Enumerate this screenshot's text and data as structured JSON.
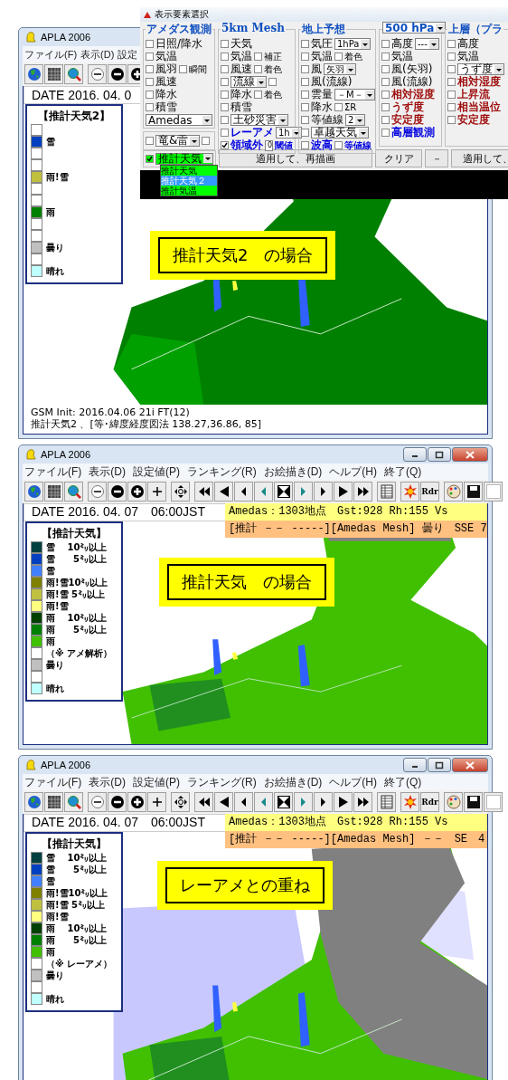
{
  "dialog": {
    "title": "表示要素選択",
    "columns": [
      {
        "groups": [
          {
            "title": "アメダス観測",
            "rows": [
              [
                {
                  "kind": "check",
                  "checked": false,
                  "label": "日照/降水"
                }
              ],
              [
                {
                  "kind": "check",
                  "checked": false,
                  "label": "気温"
                }
              ],
              [
                {
                  "kind": "check",
                  "checked": false,
                  "label": "風羽"
                },
                {
                  "kind": "check",
                  "checked": false,
                  "label": "瞬間"
                }
              ],
              [
                {
                  "kind": "check",
                  "checked": false,
                  "label": "風速"
                }
              ],
              [
                {
                  "kind": "check",
                  "checked": false,
                  "label": "降水"
                }
              ],
              [
                {
                  "kind": "check",
                  "checked": false,
                  "label": "積雪"
                }
              ],
              [
                {
                  "kind": "select",
                  "value": "Amedas"
                }
              ]
            ]
          },
          {
            "rows": [
              [
                {
                  "kind": "check",
                  "checked": false
                },
                {
                  "kind": "select",
                  "value": "竜&雷"
                },
                {
                  "kind": "check",
                  "checked": false
                }
              ]
            ]
          }
        ]
      },
      {
        "groups": [
          {
            "title": "5km Mesh",
            "rows": [
              [
                {
                  "kind": "check",
                  "checked": false,
                  "label": "天気"
                }
              ],
              [
                {
                  "kind": "check",
                  "checked": false,
                  "label": "気温"
                },
                {
                  "kind": "check",
                  "checked": false,
                  "label": "補正"
                }
              ],
              [
                {
                  "kind": "check",
                  "checked": false,
                  "label": "風速"
                },
                {
                  "kind": "check",
                  "checked": false,
                  "label": "着色"
                }
              ],
              [
                {
                  "kind": "check",
                  "checked": false
                },
                {
                  "kind": "select",
                  "value": "流線"
                },
                {
                  "kind": "check",
                  "checked": false
                }
              ],
              [
                {
                  "kind": "check",
                  "checked": false,
                  "label": "降水"
                },
                {
                  "kind": "check",
                  "checked": false,
                  "label": "着色"
                }
              ],
              [
                {
                  "kind": "check",
                  "checked": false,
                  "label": "積雪"
                }
              ],
              [
                {
                  "kind": "check",
                  "checked": false
                },
                {
                  "kind": "select",
                  "value": "土砂災害"
                }
              ],
              [
                {
                  "kind": "check",
                  "checked": false,
                  "label": "レーアメ",
                  "color": "#0000e0"
                },
                {
                  "kind": "select",
                  "value": "1h"
                }
              ],
              [
                {
                  "kind": "check",
                  "checked": true,
                  "label": "領域外",
                  "color": "#0000e0"
                },
                {
                  "kind": "input",
                  "value": "0"
                },
                {
                  "kind": "text",
                  "text": "閾値",
                  "color": "#0000e0"
                }
              ]
            ]
          }
        ]
      },
      {
        "groups": [
          {
            "title": "地上予想",
            "rows": [
              [
                {
                  "kind": "check",
                  "checked": false,
                  "label": "気圧"
                },
                {
                  "kind": "select",
                  "value": "1hPa"
                }
              ],
              [
                {
                  "kind": "check",
                  "checked": false,
                  "label": "気温"
                },
                {
                  "kind": "check",
                  "checked": false,
                  "label": "着色"
                }
              ],
              [
                {
                  "kind": "check",
                  "checked": false,
                  "label": "風"
                },
                {
                  "kind": "select",
                  "value": "矢羽"
                }
              ],
              [
                {
                  "kind": "check",
                  "checked": false,
                  "label": "風(流線)"
                }
              ],
              [
                {
                  "kind": "check",
                  "checked": false,
                  "label": "雲量"
                },
                {
                  "kind": "select",
                  "value": "－M－"
                }
              ],
              [
                {
                  "kind": "check",
                  "checked": false,
                  "label": "降水"
                },
                {
                  "kind": "check",
                  "checked": false,
                  "label": "ΣR"
                }
              ],
              [
                {
                  "kind": "check",
                  "checked": false,
                  "label": "等値線"
                },
                {
                  "kind": "select",
                  "value": "2"
                }
              ],
              [
                {
                  "kind": "check",
                  "checked": false
                },
                {
                  "kind": "select",
                  "value": "卓越天気"
                }
              ],
              [
                {
                  "kind": "check",
                  "checked": false,
                  "label": "波高",
                  "color": "#0000e0"
                },
                {
                  "kind": "check",
                  "checked": false,
                  "label": "等値線",
                  "color": "#0000e0"
                }
              ]
            ]
          }
        ]
      },
      {
        "groups": [
          {
            "title_select": "500 hPa",
            "rows": [
              [
                {
                  "kind": "check",
                  "checked": false,
                  "label": "高度"
                },
                {
                  "kind": "select",
                  "value": "---"
                }
              ],
              [
                {
                  "kind": "check",
                  "checked": false,
                  "label": "気温"
                }
              ],
              [
                {
                  "kind": "check",
                  "checked": false,
                  "label": "風(矢羽)"
                }
              ],
              [
                {
                  "kind": "check",
                  "checked": false,
                  "label": "風(流線)"
                }
              ],
              [
                {
                  "kind": "check",
                  "checked": false,
                  "label": "相対湿度",
                  "color": "#a01010"
                }
              ],
              [
                {
                  "kind": "check",
                  "checked": false,
                  "label": "うず度",
                  "color": "#a01010"
                }
              ],
              [
                {
                  "kind": "check",
                  "checked": false,
                  "label": "安定度",
                  "color": "#a01010"
                }
              ],
              [
                {
                  "kind": "check",
                  "checked": false,
                  "label": "高層観測",
                  "color": "#0000e0"
                }
              ]
            ]
          }
        ]
      },
      {
        "groups": [
          {
            "title": "上層（プラ",
            "rows": [
              [
                {
                  "kind": "check",
                  "checked": false,
                  "label": "高度"
                }
              ],
              [
                {
                  "kind": "check",
                  "checked": false,
                  "label": "気温"
                }
              ],
              [
                {
                  "kind": "check",
                  "checked": false
                },
                {
                  "kind": "select",
                  "value": "うず度"
                }
              ],
              [
                {
                  "kind": "check",
                  "checked": false,
                  "label": "相対湿度",
                  "color": "#a01010"
                }
              ],
              [
                {
                  "kind": "check",
                  "checked": false,
                  "label": "上昇流",
                  "color": "#a01010"
                }
              ],
              [
                {
                  "kind": "check",
                  "checked": false,
                  "label": "相当温位",
                  "color": "#a01010"
                }
              ],
              [
                {
                  "kind": "check",
                  "checked": false,
                  "label": "安定度",
                  "color": "#a01010"
                }
              ]
            ]
          }
        ]
      }
    ],
    "weather": {
      "checked": true,
      "value": "推計天気"
    },
    "buttons": [
      "適用して、再描画",
      "クリア",
      "－",
      "適用して、"
    ],
    "options": [
      {
        "label": "推計天気",
        "selected": false
      },
      {
        "label": "推計天気２",
        "selected": true
      },
      {
        "label": "推計気温",
        "selected": false
      }
    ]
  },
  "windows": [
    {
      "title": "APLA 2006",
      "menu": [
        "ファイル(F)",
        "表示(D)",
        "設定"
      ],
      "toolbar": [
        [
          {
            "kind": "globe"
          },
          {
            "kind": "grid"
          },
          {
            "kind": "search-globe"
          }
        ],
        [
          {
            "kind": "minus"
          },
          {
            "kind": "minus-circle"
          },
          {
            "kind": "plus-circle"
          }
        ]
      ],
      "date": "DATE 2016. 04. 0",
      "legend": {
        "title": "【推計天気2】",
        "rows": [
          {
            "color": "#ffffff"
          },
          {
            "label": "雪",
            "color": "#0040c0"
          },
          {
            "color": "#ffffff"
          },
          {
            "color": "#ffffff"
          },
          {
            "label": "雨!雪",
            "color": "#c0c040"
          },
          {
            "color": "#ffffff"
          },
          {
            "color": "#ffffff"
          },
          {
            "label": "雨",
            "color": "#008000"
          },
          {
            "color": "#ffffff"
          },
          {
            "color": "#ffffff"
          },
          {
            "label": "曇り",
            "color": "#c0c0c0"
          },
          {
            "color": "#ffffff"
          },
          {
            "label": "晴れ",
            "color": "#c0ffff"
          }
        ]
      },
      "caption": "推計天気2　の場合",
      "status": [
        "GSM Init: 2016.04.06 21i FT(12)",
        "推計天気2 、[等･緯度経度図法 138.27,36.86, 85]"
      ]
    },
    {
      "title": "APLA 2006",
      "controls": true,
      "menu": [
        "ファイル(F)",
        "表示(D)",
        "設定値(P)",
        "ランキング(R)",
        "お絵描き(D)",
        "ヘルプ(H)",
        "終了(Q)"
      ],
      "toolbar": [
        [
          {
            "kind": "globe"
          },
          {
            "kind": "grid"
          },
          {
            "kind": "search-globe"
          }
        ],
        [
          {
            "kind": "minus"
          },
          {
            "kind": "minus-circle"
          },
          {
            "kind": "plus-circle"
          },
          {
            "kind": "plus"
          }
        ],
        [
          {
            "kind": "move"
          }
        ],
        [
          {
            "kind": "skip-back"
          },
          {
            "kind": "back-large"
          },
          {
            "kind": "back"
          },
          {
            "kind": "back-teal"
          },
          {
            "kind": "hourglass"
          },
          {
            "kind": "forward-teal"
          },
          {
            "kind": "forward"
          },
          {
            "kind": "forward-large"
          },
          {
            "kind": "skip-forward"
          }
        ],
        [
          {
            "kind": "table"
          }
        ],
        [
          {
            "kind": "sun"
          },
          {
            "kind": "text",
            "text": "Rdr"
          }
        ],
        [
          {
            "kind": "palette"
          },
          {
            "kind": "floppy"
          },
          {
            "kind": "blank"
          }
        ]
      ],
      "date": "DATE 2016. 04. 07　06:00JST",
      "info": [
        "Amedas：1303地点　Gst:928 Rh:155 Vs",
        "[推計 －－ -----][Amedas Mesh] 曇り　SSE 7"
      ],
      "legend": {
        "title": "【推計天気】",
        "rows": [
          {
            "label": "雪　 10㍉以上",
            "color": "#004040"
          },
          {
            "label": "雪　　5㍉以上",
            "color": "#0040c0"
          },
          {
            "label": "雪",
            "color": "#4080ff"
          },
          {
            "label": "雨!雪10㍉以上",
            "color": "#808000"
          },
          {
            "label": "雨!雪 5㍉以上",
            "color": "#c0c040"
          },
          {
            "label": "雨!雪",
            "color": "#ffff80"
          },
          {
            "label": "雨　 10㍉以上",
            "color": "#004000"
          },
          {
            "label": "雨　　5㍉以上",
            "color": "#008000"
          },
          {
            "label": "雨",
            "color": "#40c000"
          },
          {
            "label": "（※ アメ解析）",
            "color": "#ffffff"
          },
          {
            "label": "曇り",
            "color": "#c0c0c0"
          },
          {
            "color": "#ffffff"
          },
          {
            "label": "晴れ",
            "color": "#c0ffff"
          }
        ]
      },
      "caption": "推計天気　の場合"
    },
    {
      "title": "APLA 2006",
      "controls": true,
      "menu": [
        "ファイル(F)",
        "表示(D)",
        "設定値(P)",
        "ランキング(R)",
        "お絵描き(D)",
        "ヘルプ(H)",
        "終了(Q)"
      ],
      "toolbar": [
        [
          {
            "kind": "globe"
          },
          {
            "kind": "grid"
          },
          {
            "kind": "search-globe"
          }
        ],
        [
          {
            "kind": "minus"
          },
          {
            "kind": "minus-circle"
          },
          {
            "kind": "plus-circle"
          },
          {
            "kind": "plus"
          }
        ],
        [
          {
            "kind": "move"
          }
        ],
        [
          {
            "kind": "skip-back"
          },
          {
            "kind": "back-large"
          },
          {
            "kind": "back"
          },
          {
            "kind": "back-teal"
          },
          {
            "kind": "hourglass"
          },
          {
            "kind": "forward-teal"
          },
          {
            "kind": "forward"
          },
          {
            "kind": "forward-large"
          },
          {
            "kind": "skip-forward"
          }
        ],
        [
          {
            "kind": "table"
          }
        ],
        [
          {
            "kind": "sun"
          },
          {
            "kind": "text",
            "text": "Rdr"
          }
        ],
        [
          {
            "kind": "palette"
          },
          {
            "kind": "floppy"
          },
          {
            "kind": "blank"
          }
        ]
      ],
      "date": "DATE 2016. 04. 07　06:00JST",
      "info": [
        "Amedas：1303地点　Gst:928 Rh:155 Vs",
        "[推計 －－ -----][Amedas Mesh] －－　SE　4"
      ],
      "legend": {
        "title": "【推計天気】",
        "rows": [
          {
            "label": "雪　 10㍉以上",
            "color": "#004040"
          },
          {
            "label": "雪　　5㍉以上",
            "color": "#0040c0"
          },
          {
            "label": "雪",
            "color": "#4080ff"
          },
          {
            "label": "雨!雪10㍉以上",
            "color": "#808000"
          },
          {
            "label": "雨!雪 5㍉以上",
            "color": "#c0c040"
          },
          {
            "label": "雨!雪",
            "color": "#ffff80"
          },
          {
            "label": "雨　 10㍉以上",
            "color": "#004000"
          },
          {
            "label": "雨　　5㍉以上",
            "color": "#008000"
          },
          {
            "label": "雨",
            "color": "#40c000"
          },
          {
            "label": "（※ レーアメ）",
            "color": "#ffffff"
          },
          {
            "label": "曇り",
            "color": "#c0c0c0"
          },
          {
            "color": "#ffffff"
          },
          {
            "label": "晴れ",
            "color": "#c0ffff"
          }
        ]
      },
      "caption": "レーアメとの重ね"
    }
  ]
}
